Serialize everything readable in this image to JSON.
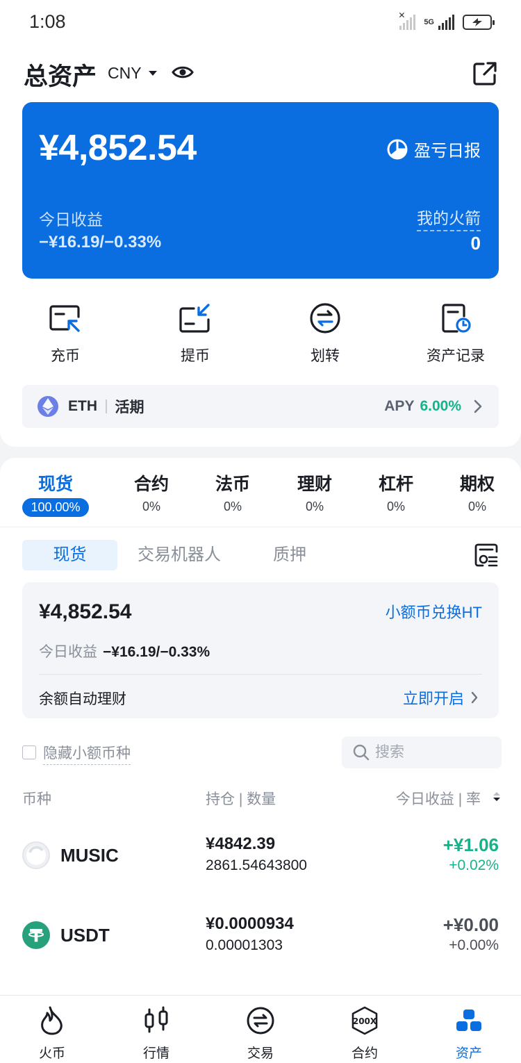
{
  "status_bar": {
    "time": "1:08",
    "network": "5G"
  },
  "header": {
    "title": "总资产",
    "currency": "CNY"
  },
  "asset_card": {
    "total": "¥4,852.54",
    "pnl_report_label": "盈亏日报",
    "today_label": "今日收益",
    "today_value": "−¥16.19/−0.33%",
    "rocket_label": "我的火箭",
    "rocket_value": "0"
  },
  "quick_actions": [
    {
      "label": "充币",
      "icon": "deposit-icon"
    },
    {
      "label": "提币",
      "icon": "withdraw-icon"
    },
    {
      "label": "划转",
      "icon": "transfer-icon"
    },
    {
      "label": "资产记录",
      "icon": "asset-record-icon"
    }
  ],
  "eth_banner": {
    "coin": "ETH",
    "type": "活期",
    "apy_label": "APY",
    "apy_value": "6.00%"
  },
  "categories": [
    {
      "name": "现货",
      "percent": "100.00%",
      "active": true
    },
    {
      "name": "合约",
      "percent": "0%"
    },
    {
      "name": "法币",
      "percent": "0%"
    },
    {
      "name": "理财",
      "percent": "0%"
    },
    {
      "name": "杠杆",
      "percent": "0%"
    },
    {
      "name": "期权",
      "percent": "0%"
    }
  ],
  "sub_tabs": [
    "现货",
    "交易机器人",
    "质押"
  ],
  "spot_card": {
    "total": "¥4,852.54",
    "convert_link": "小额币兑换HT",
    "today_label": "今日收益",
    "today_value": "−¥16.19/−0.33%",
    "auto_label": "余额自动理财",
    "auto_action": "立即开启"
  },
  "filter": {
    "hide_small_label": "隐藏小额币种",
    "search_placeholder": "搜索"
  },
  "columns": {
    "coin": "币种",
    "holding": "持仓 | 数量",
    "today": "今日收益 | 率"
  },
  "coins": [
    {
      "name": "MUSIC",
      "value": "¥4842.39",
      "quantity": "2861.54643800",
      "pnl": "+¥1.06",
      "rate": "+0.02%"
    },
    {
      "name": "USDT",
      "value": "¥0.0000934",
      "quantity": "0.00001303",
      "pnl": "+¥0.00",
      "rate": "+0.00%"
    }
  ],
  "bottom_nav": [
    {
      "label": "火币",
      "icon": "flame-icon"
    },
    {
      "label": "行情",
      "icon": "candlestick-icon"
    },
    {
      "label": "交易",
      "icon": "exchange-icon"
    },
    {
      "label": "合约",
      "icon": "200x-icon"
    },
    {
      "label": "资产",
      "icon": "assets-icon",
      "active": true
    }
  ],
  "colors": {
    "primary": "#0a6ee0",
    "positive": "#16b38a",
    "eth": "#6c7fe6",
    "usdt": "#26a17b"
  }
}
